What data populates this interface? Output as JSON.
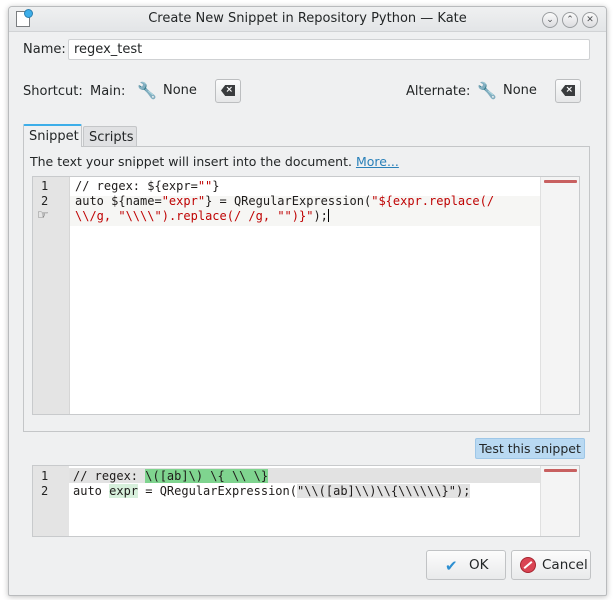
{
  "window": {
    "title": "Create New Snippet in Repository Python — Kate"
  },
  "name_field": {
    "label": "Name:",
    "value": "regex_test"
  },
  "shortcut": {
    "label": "Shortcut:",
    "main_label": "Main:",
    "main_value": "None",
    "alternate_label": "Alternate:",
    "alternate_value": "None"
  },
  "tabs": [
    {
      "label": "Snippet",
      "active": true
    },
    {
      "label": "Scripts",
      "active": false
    }
  ],
  "snippet": {
    "info_text": "The text your snippet will insert into the document.",
    "more_link": "More..."
  },
  "editor": {
    "line_numbers": [
      "1",
      "2"
    ],
    "lines": {
      "l1_a": "// regex: ${expr=",
      "l1_b": "\"\"",
      "l1_c": "}",
      "l2_a": "auto ${name=",
      "l2_b": "\"expr\"",
      "l2_c": "} = QRegularExpression(",
      "l2_d": "\"${expr.replace(/",
      "l3_a": "\\\\/g, ",
      "l3_b": "\"\\\\\\\\\"",
      "l3_c": ").replace(/ /g, ",
      "l3_d": "\"\"",
      "l3_e": ")}\"",
      "l3_f": ");"
    }
  },
  "test_button": {
    "label": "Test this snippet"
  },
  "preview": {
    "line_numbers": [
      "1",
      "2"
    ],
    "l1_a": "// regex: ",
    "l1_b": "\\([ab]\\) \\{ \\\\ \\}",
    "l2_a": "auto ",
    "l2_b": "expr",
    "l2_c": " = QRegularExpression(",
    "l2_d": "\"\\\\([ab]\\\\)\\\\{\\\\\\\\\\\\}\"",
    "l2_e": ");"
  },
  "buttons": {
    "ok": "OK",
    "cancel": "Cancel"
  },
  "colors": {
    "accent": "#3daee9",
    "string": "#bf0303",
    "highlight": "#7fd48f"
  }
}
